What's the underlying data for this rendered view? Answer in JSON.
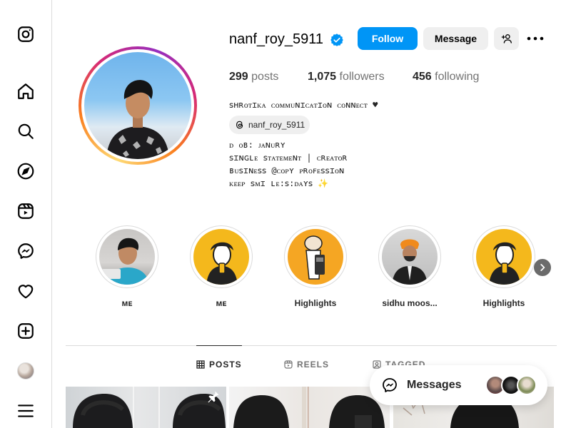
{
  "sidebar": {
    "items": [
      {
        "name": "instagram-logo-icon"
      },
      {
        "name": "home-icon"
      },
      {
        "name": "search-icon"
      },
      {
        "name": "explore-icon"
      },
      {
        "name": "reels-icon"
      },
      {
        "name": "messenger-icon"
      },
      {
        "name": "notifications-heart-icon"
      },
      {
        "name": "create-plus-icon"
      },
      {
        "name": "profile-avatar"
      },
      {
        "name": "more-menu-icon"
      }
    ]
  },
  "profile": {
    "username": "nanf_roy_5911",
    "follow_label": "Follow",
    "message_label": "Message",
    "stats": {
      "posts_count": "299",
      "posts_label": "posts",
      "followers_count": "1,075",
      "followers_label": "followers",
      "following_count": "456",
      "following_label": "following"
    },
    "bio": {
      "line1": "ꜱʜʀᴏᴛɪᴋᴀ ᴄᴏᴍᴍᴜɴɪᴄᴀᴛɪᴏɴ ᴄᴏɴɴᴇᴄᴛ ♥",
      "threads_handle": "nanf_roy_5911",
      "line2": "ᴅ ᴏʙ: ᴊᴀɴᴜʀʏ",
      "line3": "ꜱɪɴɢʟᴇ ꜱᴛᴀᴛᴇᴍᴇɴᴛ | ᴄʀᴇᴀᴛᴏʀ",
      "line4": "ʙᴜꜱɪɴᴇꜱꜱ @ᴄᴏᴘʏ ᴘʀᴏꜰᴇꜱꜱɪᴏɴ",
      "line5": "ᴋᴇᴇᴘ ꜱᴍɪ ʟᴇ:ꜱ:ᴅᴀʏꜱ ✨"
    }
  },
  "highlights": [
    {
      "label": "ᴍᴇ"
    },
    {
      "label": "ᴍᴇ"
    },
    {
      "label": "Highlights"
    },
    {
      "label": "sidhu moos..."
    },
    {
      "label": "Highlights"
    }
  ],
  "tabs": [
    {
      "label": "POSTS",
      "active": true
    },
    {
      "label": "REELS",
      "active": false
    },
    {
      "label": "TAGGED",
      "active": false
    }
  ],
  "messages": {
    "label": "Messages"
  },
  "colors": {
    "accent": "#0095f6",
    "verified": "#0095f6",
    "border": "#dbdbdb",
    "text": "#262626",
    "muted": "#737373"
  }
}
